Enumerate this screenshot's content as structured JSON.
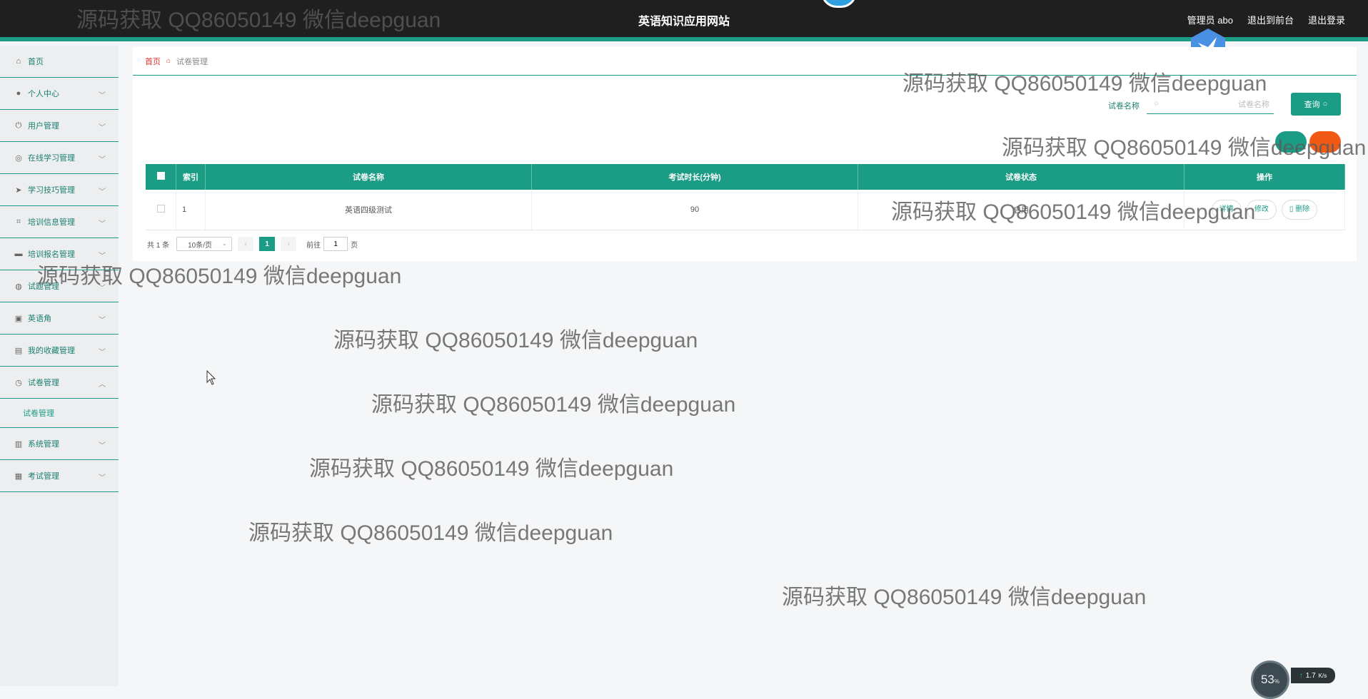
{
  "header": {
    "site_title": "英语知识应用网站",
    "admin_label": "管理员 abo",
    "to_frontend": "退出到前台",
    "logout": "退出登录"
  },
  "sidebar": {
    "items": [
      {
        "label": "首页",
        "icon": "home-icon"
      },
      {
        "label": "个人中心",
        "icon": "user-icon"
      },
      {
        "label": "用户管理",
        "icon": "power-icon"
      },
      {
        "label": "在线学习管理",
        "icon": "compass-icon"
      },
      {
        "label": "学习技巧管理",
        "icon": "send-icon"
      },
      {
        "label": "培训信息管理",
        "icon": "crop-icon"
      },
      {
        "label": "培训报名管理",
        "icon": "chat-icon"
      },
      {
        "label": "试题管理",
        "icon": "globe-icon"
      },
      {
        "label": "英语角",
        "icon": "briefcase-icon"
      },
      {
        "label": "我的收藏管理",
        "icon": "notebook-icon"
      },
      {
        "label": "试卷管理",
        "icon": "clock-icon"
      },
      {
        "label": "系统管理",
        "icon": "clipboard-icon"
      },
      {
        "label": "考试管理",
        "icon": "clipboard-check-icon"
      }
    ],
    "submenu": {
      "label": "试卷管理"
    }
  },
  "breadcrumb": {
    "home": "首页",
    "current": "试卷管理"
  },
  "search": {
    "label": "试卷名称",
    "placeholder": "试卷名称",
    "button": "查询"
  },
  "table": {
    "headers": [
      "索引",
      "试卷名称",
      "考试时长(分钟)",
      "试卷状态",
      "操作"
    ],
    "rows": [
      {
        "index": "1",
        "name": "英语四级测试",
        "duration": "90",
        "status": "启用"
      }
    ],
    "ops": {
      "view": "详情",
      "edit": "修改",
      "delete": "删除"
    }
  },
  "pagination": {
    "total": "共 1 条",
    "page_size": "10条/页",
    "current_page": "1",
    "goto_prefix": "前往",
    "goto_value": "1",
    "goto_suffix": "页"
  },
  "watermark": "源码获取 QQ86050149 微信deepguan",
  "net_widget": {
    "percent": "53",
    "percent_unit": "%",
    "speed": "1.7",
    "speed_unit": "K/s"
  },
  "colors": {
    "accent": "#1a9c85",
    "header_bg": "#1f1f1f",
    "danger": "#f05a14",
    "breadcrumb_home": "#e0342b"
  }
}
